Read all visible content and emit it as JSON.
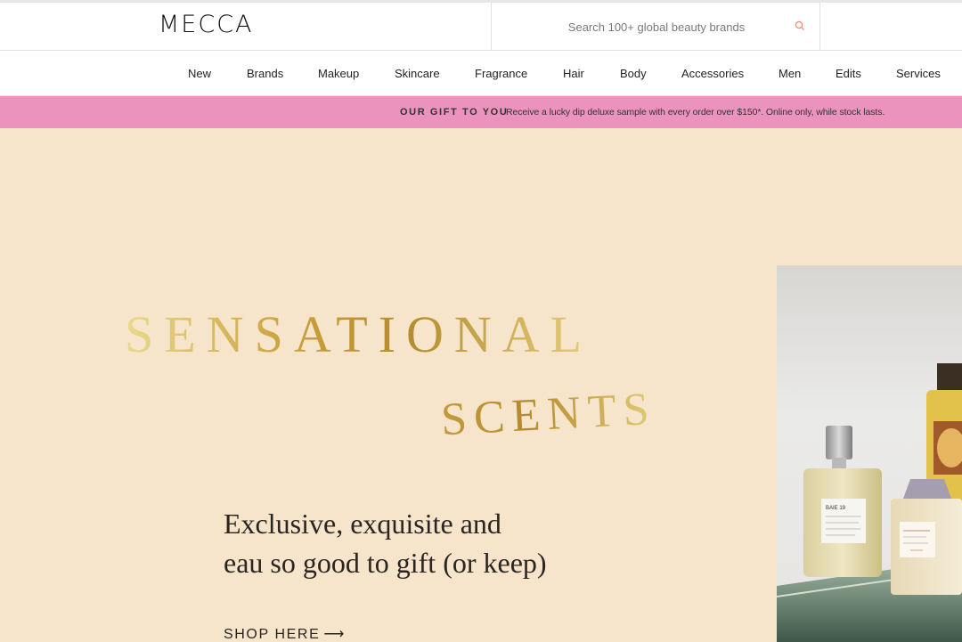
{
  "header": {
    "logo": "MECCA",
    "search_placeholder": "Search 100+ global beauty brands"
  },
  "nav": {
    "items": [
      "New",
      "Brands",
      "Makeup",
      "Skincare",
      "Fragrance",
      "Hair",
      "Body",
      "Accessories",
      "Men",
      "Edits",
      "Services"
    ]
  },
  "promo": {
    "title": "OUR GIFT TO YOU",
    "text": "Receive a lucky dip deluxe sample with every order over $150*. Online only, while stock lasts."
  },
  "hero": {
    "headline_1": "SENSATIONAL",
    "headline_2": "SCENTS",
    "subtitle_line_1": "Exclusive, exquisite and",
    "subtitle_line_2": "eau so good to gift (or keep)",
    "cta_label": "SHOP HERE",
    "cta_arrow": "⟶",
    "bottle_label": "BAIE 19"
  },
  "colors": {
    "promo_bg": "#ec93bd",
    "hero_bg": "#f6e4cb",
    "gold": "#c39b3c",
    "search_icon": "#e88a6b"
  }
}
